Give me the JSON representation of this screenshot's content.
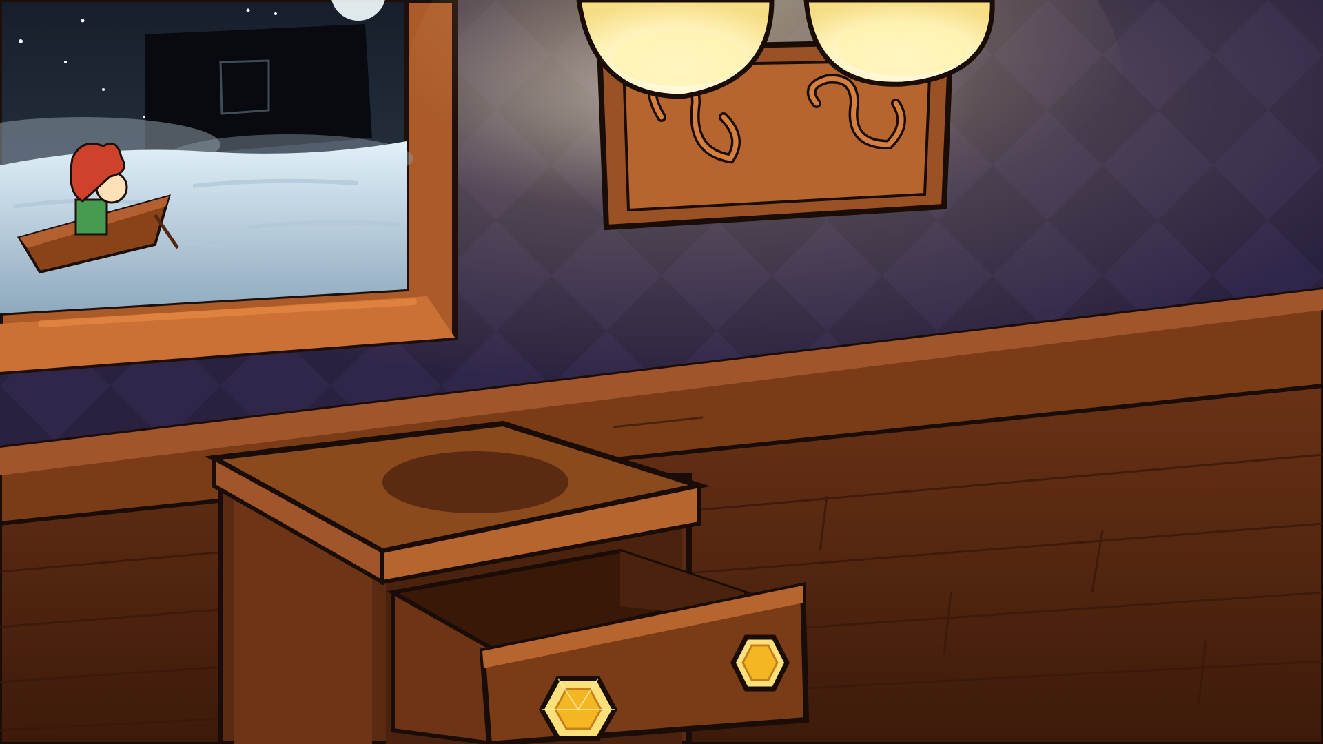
{
  "scene": {
    "kind": "point-and-click room",
    "palette": {
      "wall": "#2c2340",
      "wall_diamond": "#362b4d",
      "wood": "#8a4a1c",
      "wood_light": "#b2652c",
      "wood_dark": "#4a2310",
      "floor": "#5a2a12",
      "outline": "#1a0d08",
      "lamp_glow": "#fff6c8",
      "gem": "#f5b623",
      "sea": "#8fa6b8",
      "night_sky": "#1a2230"
    },
    "objects": [
      {
        "id": "painting",
        "label": ""
      },
      {
        "id": "wall-lamp",
        "label": ""
      },
      {
        "id": "nightstand",
        "label": ""
      },
      {
        "id": "drawer",
        "label": ""
      },
      {
        "id": "gem-knob-left",
        "label": ""
      },
      {
        "id": "gem-knob-right",
        "label": ""
      }
    ]
  }
}
